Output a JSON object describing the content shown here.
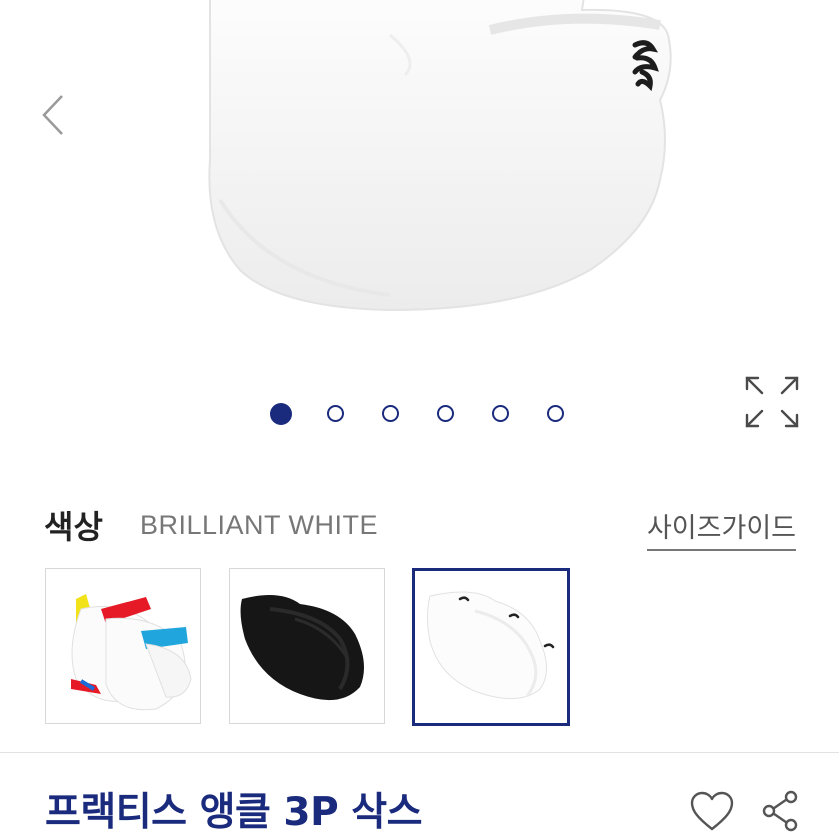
{
  "gallery": {
    "image": "brilliant-white-ankle-sock",
    "prev_icon": "chevron-left-icon",
    "expand_icon": "expand-icon",
    "total_images": 6,
    "current_index": 1
  },
  "color": {
    "label": "색상",
    "selected_value": "BRILLIANT WHITE",
    "options": [
      {
        "name": "multicolor-socks"
      },
      {
        "name": "black-socks"
      },
      {
        "name": "brilliant-white-socks",
        "selected": true
      }
    ]
  },
  "size_guide": {
    "label": "사이즈가이드"
  },
  "product": {
    "name": "프랙티스 앵클 3P 삭스"
  },
  "actions": {
    "wishlist_icon": "heart-icon",
    "share_icon": "share-icon"
  },
  "colors": {
    "brand_navy": "#1a2a7c",
    "muted_text": "#777777"
  }
}
